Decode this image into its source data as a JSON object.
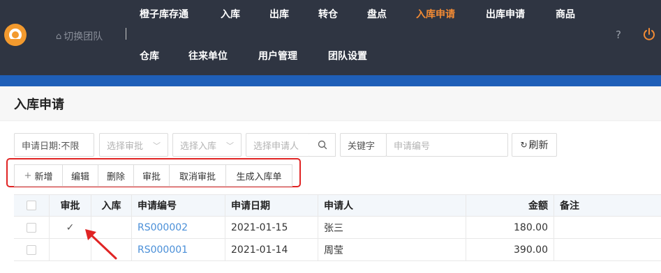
{
  "nav": {
    "row1": [
      {
        "label": "橙子库存通",
        "active": false
      },
      {
        "label": "入库",
        "active": false
      },
      {
        "label": "出库",
        "active": false
      },
      {
        "label": "转仓",
        "active": false
      },
      {
        "label": "盘点",
        "active": false
      },
      {
        "label": "入库申请",
        "active": true
      },
      {
        "label": "出库申请",
        "active": false
      },
      {
        "label": "商品",
        "active": false
      }
    ],
    "row2": [
      {
        "label": "仓库"
      },
      {
        "label": "往来单位"
      },
      {
        "label": "用户管理"
      },
      {
        "label": "团队设置"
      }
    ],
    "team_switch": "切换团队",
    "help": "?",
    "accent_color": "#f38b34"
  },
  "page": {
    "title": "入库申请"
  },
  "filters": {
    "date": "申请日期:不限",
    "approval_placeholder": "选择审批",
    "stockin_placeholder": "选择入库",
    "applicant_placeholder": "选择申请人",
    "keyword_label": "关键字",
    "number_placeholder": "申请编号",
    "refresh": "刷新"
  },
  "toolbar": {
    "add": "新增",
    "edit": "编辑",
    "delete": "删除",
    "approve": "审批",
    "cancel_approve": "取消审批",
    "generate": "生成入库单"
  },
  "table": {
    "headers": {
      "approved": "审批",
      "stocked": "入库",
      "number": "申请编号",
      "date": "申请日期",
      "applicant": "申请人",
      "amount": "金额",
      "note": "备注"
    },
    "rows": [
      {
        "approved": "✓",
        "stocked": "",
        "number": "RS000002",
        "date": "2021-01-15",
        "applicant": "张三",
        "amount": "180.00",
        "note": ""
      },
      {
        "approved": "",
        "stocked": "",
        "number": "RS000001",
        "date": "2021-01-14",
        "applicant": "周莹",
        "amount": "390.00",
        "note": ""
      }
    ]
  }
}
